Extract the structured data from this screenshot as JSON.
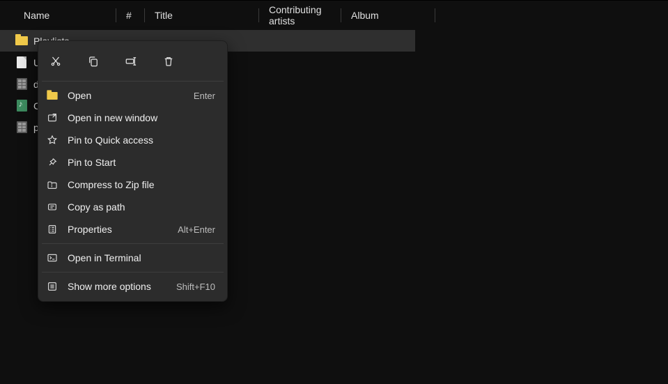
{
  "columns": {
    "name": "Name",
    "hash": "#",
    "title": "Title",
    "contrib": "Contributing artists",
    "album": "Album"
  },
  "files": [
    {
      "name": "Playlists",
      "icon": "folder",
      "selected": true
    },
    {
      "name": "U",
      "icon": "generic"
    },
    {
      "name": "d",
      "icon": "grid"
    },
    {
      "name": "C",
      "icon": "music"
    },
    {
      "name": "pa",
      "icon": "grid"
    }
  ],
  "context_menu": {
    "icon_actions": [
      "cut",
      "copy",
      "rename",
      "delete"
    ],
    "items": [
      {
        "icon": "folder-open",
        "label": "Open",
        "accel": "Enter"
      },
      {
        "icon": "new-window",
        "label": "Open in new window"
      },
      {
        "icon": "star",
        "label": "Pin to Quick access"
      },
      {
        "icon": "pin",
        "label": "Pin to Start"
      },
      {
        "icon": "zip",
        "label": "Compress to Zip file"
      },
      {
        "icon": "copy-path",
        "label": "Copy as path"
      },
      {
        "icon": "properties",
        "label": "Properties",
        "accel": "Alt+Enter"
      }
    ],
    "group2": [
      {
        "icon": "terminal",
        "label": "Open in Terminal"
      }
    ],
    "group3": [
      {
        "icon": "more",
        "label": "Show more options",
        "accel": "Shift+F10"
      }
    ]
  }
}
